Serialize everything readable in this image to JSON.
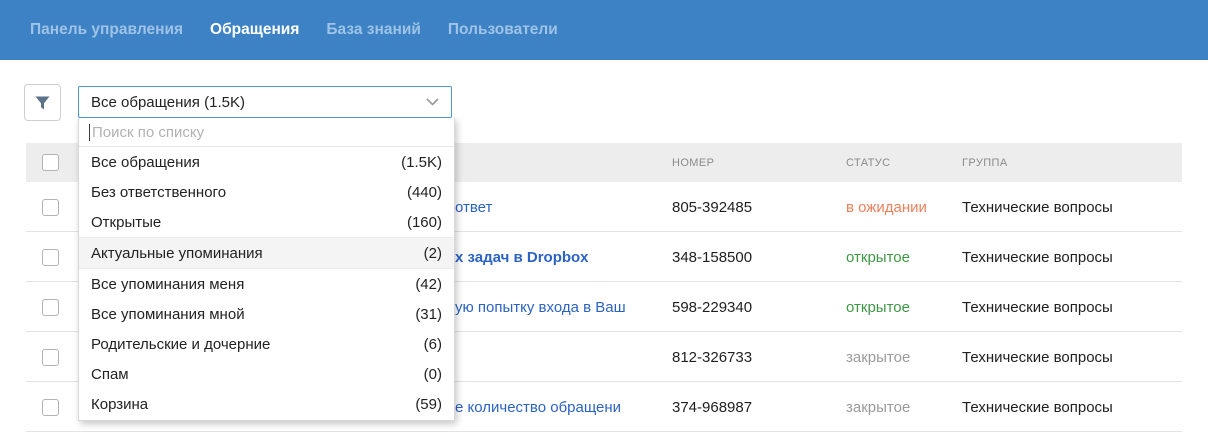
{
  "nav": {
    "tabs": [
      {
        "label": "Панель управления"
      },
      {
        "label": "Обращения"
      },
      {
        "label": "База знаний"
      },
      {
        "label": "Пользователи"
      }
    ]
  },
  "filter": {
    "selected_value": "Все обращения (1.5K)",
    "search_placeholder": "Поиск по списку",
    "options": [
      {
        "label": "Все обращения",
        "count": "(1.5K)"
      },
      {
        "label": "Без ответственного",
        "count": "(440)"
      },
      {
        "label": "Открытые",
        "count": "(160)"
      },
      {
        "label": "Актуальные упоминания",
        "count": "(2)"
      },
      {
        "label": "Все упоминания меня",
        "count": "(42)"
      },
      {
        "label": "Все упоминания мной",
        "count": "(31)"
      },
      {
        "label": "Родительские и дочерние",
        "count": "(6)"
      },
      {
        "label": "Спам",
        "count": "(0)"
      },
      {
        "label": "Корзина",
        "count": "(59)"
      }
    ]
  },
  "table": {
    "headers": {
      "number": "НОМЕР",
      "status": "СТАТУС",
      "group": "ГРУППА"
    },
    "rows": [
      {
        "subject_visible": "ответ",
        "number": "805-392485",
        "status": "в ожидании",
        "group": "Технические вопросы"
      },
      {
        "subject_visible": "х задач в Dropbox",
        "number": "348-158500",
        "status": "открытое",
        "group": "Технические вопросы"
      },
      {
        "subject_visible": "ую попытку входа в Ваш",
        "number": "598-229340",
        "status": "открытое",
        "group": "Технические вопросы"
      },
      {
        "subject_visible": "",
        "number": "812-326733",
        "status": "закрытое",
        "group": "Технические вопросы"
      },
      {
        "subject_visible": "е количество обращени",
        "number": "374-968987",
        "status": "закрытое",
        "group": "Технические вопросы"
      }
    ]
  },
  "colors": {
    "nav_bg": "#3c82c5",
    "nav_inactive": "#9fc3e6",
    "link": "#2b63c4",
    "status_pending": "#ee7f5a",
    "status_open": "#3f9845",
    "status_closed": "#9b9b9b",
    "select_border": "#4f97d6"
  }
}
